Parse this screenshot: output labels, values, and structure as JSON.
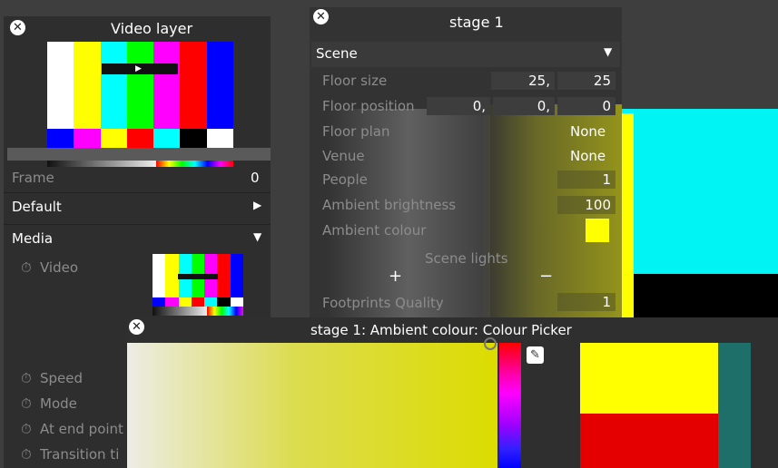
{
  "video_panel": {
    "title": "Video layer",
    "frame_label": "Frame",
    "frame_value": "0",
    "default_label": "Default",
    "media_label": "Media",
    "params": [
      "Video",
      "Speed",
      "Mode",
      "At end point",
      "Transition ti"
    ]
  },
  "stage_panel": {
    "title": "stage 1",
    "section": "Scene",
    "floor_size": {
      "label": "Floor size",
      "values": [
        "25,",
        "25"
      ]
    },
    "floor_position": {
      "label": "Floor position",
      "values": [
        "0,",
        "0,",
        "0"
      ]
    },
    "floor_plan": {
      "label": "Floor plan",
      "value": "None"
    },
    "venue": {
      "label": "Venue",
      "value": "None"
    },
    "people": {
      "label": "People",
      "value": "1"
    },
    "ambient_brightness": {
      "label": "Ambient brightness",
      "value": "100"
    },
    "ambient_colour": {
      "label": "Ambient colour",
      "color": "#ffff00"
    },
    "scene_lights": {
      "label": "Scene lights",
      "add": "+",
      "remove": "−"
    },
    "footprints_quality": {
      "label": "Footprints Quality",
      "value": "1"
    }
  },
  "picker": {
    "title": "stage 1: Ambient colour: Colour Picker",
    "new_color": "#ffff00",
    "old_color": "#e40000"
  },
  "icons": {
    "close": "✕",
    "expand": "▶",
    "collapse": "▼",
    "timer": "⏱",
    "eyedropper": "✎"
  },
  "testcard": {
    "top_colors": [
      "#ffffff",
      "#ffff00",
      "#00ffff",
      "#00ff00",
      "#ff00ff",
      "#ff0000",
      "#0000ff"
    ],
    "mid_colors": [
      "#0000ff",
      "#ff00ff",
      "#ffff00",
      "#ff0000",
      "#00ffff",
      "#000000",
      "#ffffff"
    ]
  }
}
